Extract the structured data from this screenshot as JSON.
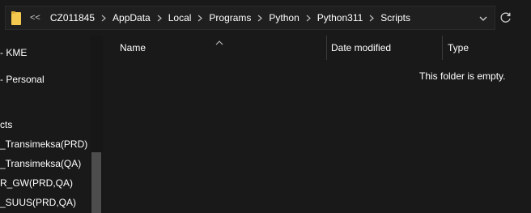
{
  "address_bar": {
    "overflow": "<<",
    "crumbs": [
      "CZ011845",
      "AppData",
      "Local",
      "Programs",
      "Python",
      "Python311",
      "Scripts"
    ]
  },
  "nav": {
    "items": [
      "- KME",
      "- Personal",
      "cts",
      "_Transimeksa(PRD)",
      "_Transimeksa(QA)",
      "R_GW(PRD,QA)",
      "_SUUS(PRD,QA)"
    ]
  },
  "content": {
    "columns": [
      "Name",
      "Date modified",
      "Type"
    ],
    "empty_message": "This folder is empty."
  },
  "colors": {
    "background": "#191919",
    "folder": "#f4c84e",
    "text": "#ffffff"
  },
  "icons": {
    "folder": "folder-icon",
    "dropdown": "chevron-down-icon",
    "refresh": "refresh-icon",
    "sort": "sort-up-icon"
  }
}
